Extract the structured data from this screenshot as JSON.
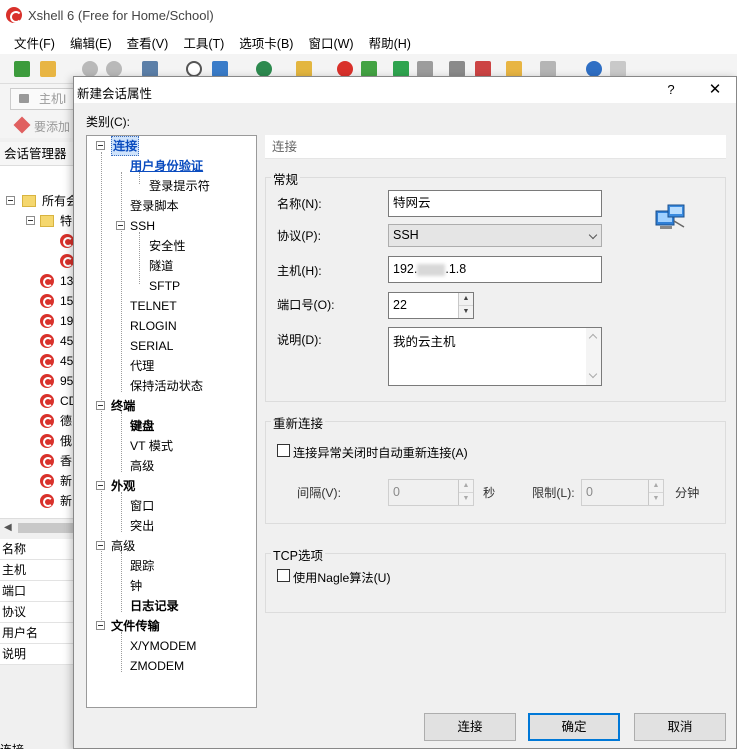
{
  "app": {
    "title": "Xshell 6 (Free for Home/School)",
    "menu": [
      "文件(F)",
      "编辑(E)",
      "查看(V)",
      "工具(T)",
      "选项卡(B)",
      "窗口(W)",
      "帮助(H)"
    ],
    "address_placeholder": "主机I",
    "hint_text": "要添加",
    "session_manager_title": "会话管理器",
    "session_tree": [
      {
        "label": "所有会",
        "type": "folder"
      },
      {
        "label": "特",
        "type": "folder"
      },
      {
        "label": "",
        "type": "session"
      },
      {
        "label": "",
        "type": "session"
      },
      {
        "label": "13",
        "type": "session"
      },
      {
        "label": "15",
        "type": "session"
      },
      {
        "label": "19",
        "type": "session"
      },
      {
        "label": "45",
        "type": "session"
      },
      {
        "label": "45",
        "type": "session"
      },
      {
        "label": "95",
        "type": "session"
      },
      {
        "label": "CD",
        "type": "session"
      },
      {
        "label": "德",
        "type": "session"
      },
      {
        "label": "俄",
        "type": "session"
      },
      {
        "label": "香",
        "type": "session"
      },
      {
        "label": "新",
        "type": "session"
      },
      {
        "label": "新",
        "type": "session"
      }
    ],
    "properties": [
      "名称",
      "主机",
      "端口",
      "协议",
      "用户名",
      "说明"
    ],
    "status_fragment": "连接"
  },
  "dialog": {
    "title": "新建会话属性",
    "help": "?",
    "close": "✕",
    "category_label": "类别(C):",
    "tree": [
      {
        "label": "连接",
        "level": 0,
        "expander": true,
        "bold": true,
        "selected": true
      },
      {
        "label": "用户身份验证",
        "level": 1,
        "bold": true,
        "link": true
      },
      {
        "label": "登录提示符",
        "level": 2
      },
      {
        "label": "登录脚本",
        "level": 1
      },
      {
        "label": "SSH",
        "level": 1,
        "expander": true
      },
      {
        "label": "安全性",
        "level": 2
      },
      {
        "label": "隧道",
        "level": 2
      },
      {
        "label": "SFTP",
        "level": 2
      },
      {
        "label": "TELNET",
        "level": 1
      },
      {
        "label": "RLOGIN",
        "level": 1
      },
      {
        "label": "SERIAL",
        "level": 1
      },
      {
        "label": "代理",
        "level": 1
      },
      {
        "label": "保持活动状态",
        "level": 1
      },
      {
        "label": "终端",
        "level": 0,
        "expander": true,
        "bold": true
      },
      {
        "label": "键盘",
        "level": 1,
        "bold": true
      },
      {
        "label": "VT 模式",
        "level": 1
      },
      {
        "label": "高级",
        "level": 1
      },
      {
        "label": "外观",
        "level": 0,
        "expander": true,
        "bold": true
      },
      {
        "label": "窗口",
        "level": 1
      },
      {
        "label": "突出",
        "level": 1
      },
      {
        "label": "高级",
        "level": 0,
        "expander": true
      },
      {
        "label": "跟踪",
        "level": 1
      },
      {
        "label": "钟",
        "level": 1
      },
      {
        "label": "日志记录",
        "level": 1,
        "bold": true
      },
      {
        "label": "文件传输",
        "level": 0,
        "expander": true,
        "bold": true
      },
      {
        "label": "X/YMODEM",
        "level": 1
      },
      {
        "label": "ZMODEM",
        "level": 1
      }
    ],
    "section_title": "连接",
    "general": {
      "title": "常规",
      "name_label": "名称(N):",
      "name_value": "特网云",
      "protocol_label": "协议(P):",
      "protocol_value": "SSH",
      "host_label": "主机(H):",
      "host_value": "192.",
      "host_value_end": ".1.8",
      "port_label": "端口号(O):",
      "port_value": "22",
      "desc_label": "说明(D):",
      "desc_value": "我的云主机"
    },
    "reconnect": {
      "title": "重新连接",
      "checkbox_label": "连接异常关闭时自动重新连接(A)",
      "checked": false,
      "interval_label": "间隔(V):",
      "interval_value": "0",
      "interval_unit": "秒",
      "limit_label": "限制(L):",
      "limit_value": "0",
      "limit_unit": "分钟"
    },
    "tcp": {
      "title": "TCP选项",
      "checkbox_label": "使用Nagle算法(U)",
      "checked": false
    },
    "buttons": {
      "connect": "连接",
      "ok": "确定",
      "cancel": "取消"
    },
    "colors": {
      "accent": "#0078d7",
      "link": "#0b4cbf",
      "session_icon": "#d9312b"
    }
  }
}
